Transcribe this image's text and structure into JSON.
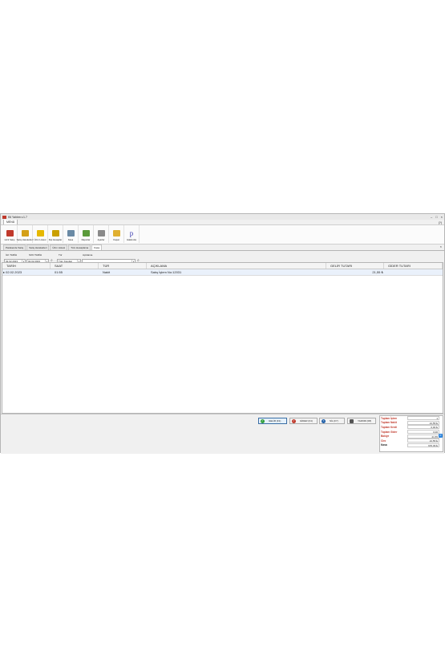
{
  "window": {
    "title": "Kti Yalıtım v.1.7"
  },
  "menu": {
    "tab": "MENÜ",
    "help": "(?)"
  },
  "ribbon": [
    {
      "label": "Hızlı Satış",
      "icon": "flag-icon",
      "color": "#c0392b"
    },
    {
      "label": "Satış Hareketleri",
      "icon": "book-icon",
      "color": "#d4a017"
    },
    {
      "label": "Ürün Listesi",
      "icon": "pencil-icon",
      "color": "#e6b800"
    },
    {
      "label": "Kişi Hesaplar",
      "icon": "coins-icon",
      "color": "#caa000"
    },
    {
      "label": "Kasa",
      "icon": "printer-icon",
      "color": "#6a8aa5"
    },
    {
      "label": "Raporlar",
      "icon": "lock-icon",
      "color": "#5a9a3a"
    },
    {
      "label": "Ayarlar",
      "icon": "tools-icon",
      "color": "#8a8a8a"
    },
    {
      "label": "Kapat",
      "icon": "folder-icon",
      "color": "#e0b030"
    },
    {
      "label": "Hakkında",
      "icon": "p-letter-icon",
      "color": "#3b3bb0"
    }
  ],
  "doc_tabs": [
    "Parakende Satış",
    "Satış Hareketleri",
    "Ürün Listesi",
    "Tüm Hesaplama",
    "Kasa"
  ],
  "filters": {
    "start_label": "İLK TARİH",
    "end_label": "SON TARİH",
    "type_label": "Tür",
    "desc_label": "Açıklama",
    "start_value": "02.02.2023",
    "end_value": "02.02.2023",
    "type_value": "Tüm Kayıtlar",
    "desc_value": ""
  },
  "grid": {
    "columns": [
      "TARİH",
      "SAAT",
      "TÜR",
      "AÇIKLAMA",
      "GELİR TUTARI",
      "GİDER TUTARI"
    ],
    "rows": [
      {
        "date": "02.02.2023",
        "time": "01:55",
        "type": "Nakit",
        "desc": "Satış İşlem No:12031",
        "income": "21,55 ₺",
        "expense": ""
      }
    ]
  },
  "actions": {
    "income": "GELİR (F1)",
    "expense": "GİDER (F4)",
    "delete": "SİL (F7)",
    "print": "YAZDIR (F8)"
  },
  "summary": [
    {
      "label": "Toplam İşlem",
      "value": "1"
    },
    {
      "label": "Toplam Nakit",
      "value": "21,55 ₺"
    },
    {
      "label": "Toplam Kredi",
      "value": "0,00 ₺"
    },
    {
      "label": "Toplam Gider",
      "value": "0,00"
    },
    {
      "label": "Bakiye",
      "value": "21,55"
    },
    {
      "label": "Ciro",
      "value": "21,55 ₺"
    },
    {
      "label": "Kasa",
      "value": "676,39 ₺"
    }
  ]
}
